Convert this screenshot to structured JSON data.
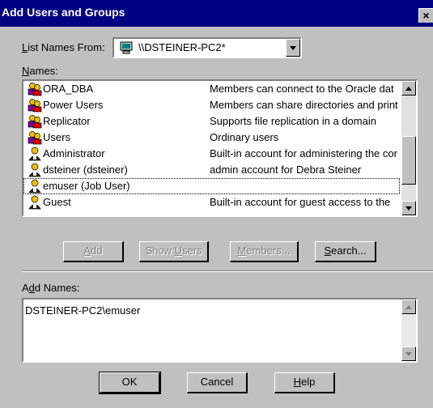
{
  "window": {
    "title": "Add Users and Groups",
    "close_glyph": "×"
  },
  "list_names_from": {
    "label_prefix": "",
    "label_accel": "L",
    "label_rest": "ist Names From:",
    "value": "\\\\DSTEINER-PC2*",
    "icon": "computer-icon"
  },
  "names": {
    "label_accel": "N",
    "label_rest": "ames:",
    "rows": [
      {
        "name": "ORA_DBA",
        "description": "Members can connect to the Oracle dat",
        "icon": "group-icon"
      },
      {
        "name": "Power Users",
        "description": "Members can share directories and print",
        "icon": "group-icon"
      },
      {
        "name": "Replicator",
        "description": "Supports file replication in a domain",
        "icon": "group-icon"
      },
      {
        "name": "Users",
        "description": "Ordinary users",
        "icon": "group-icon"
      },
      {
        "name": "Administrator",
        "description": "Built-in account for administering the cor",
        "icon": "user-icon"
      },
      {
        "name": "dsteiner (dsteiner)",
        "description": "admin account for Debra Steiner",
        "icon": "user-icon"
      },
      {
        "name": "emuser (Job User)",
        "description": "",
        "icon": "user-icon"
      },
      {
        "name": "Guest",
        "description": "Built-in account for guest access to the",
        "icon": "user-icon"
      }
    ]
  },
  "buttons": {
    "add": {
      "accel": "A",
      "rest": "dd",
      "enabled": false
    },
    "show_users": {
      "pre": "Show ",
      "accel": "U",
      "rest": "sers",
      "enabled": false
    },
    "members": {
      "accel": "M",
      "rest": "embers...",
      "enabled": false
    },
    "search": {
      "accel": "S",
      "rest": "earch...",
      "enabled": true
    }
  },
  "add_names": {
    "label_pre": "A",
    "label_accel": "d",
    "label_rest": "d Names:",
    "value": "DSTEINER-PC2\\emuser"
  },
  "footer": {
    "ok": "OK",
    "cancel": "Cancel",
    "help_accel": "H",
    "help_rest": "elp"
  },
  "colors": {
    "titlebar": "#000080",
    "face": "#c0c0c0"
  }
}
